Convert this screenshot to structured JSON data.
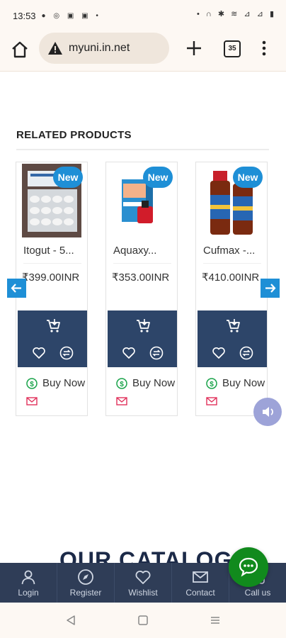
{
  "status_bar": {
    "time": "13:53",
    "left_icons": "● ◎ ▣ ▣ •",
    "right_icons": "• ∩ ✱ ≋ ⊿ ⊿ ▮"
  },
  "browser": {
    "url": "myuni.in.net",
    "tab_count": "35"
  },
  "section": {
    "title": "RELATED PRODUCTS"
  },
  "products": [
    {
      "name": "Itogut - 5...",
      "price": "₹399.00INR",
      "badge": "New",
      "buy_label": "Buy Now"
    },
    {
      "name": "Aquaxy...",
      "price": "₹353.00INR",
      "badge": "New",
      "buy_label": "Buy Now"
    },
    {
      "name": "Cufmax -...",
      "price": "₹410.00INR",
      "badge": "New",
      "buy_label": "Buy Now"
    }
  ],
  "catalog_heading": "OUR CATALOG",
  "bottom_nav": [
    {
      "label": "Login",
      "icon": "user-icon"
    },
    {
      "label": "Register",
      "icon": "compass-icon"
    },
    {
      "label": "Wishlist",
      "icon": "heart-icon"
    },
    {
      "label": "Contact",
      "icon": "mail-icon"
    },
    {
      "label": "Call us",
      "icon": "phone-icon"
    }
  ],
  "colors": {
    "accent": "#1e8fd6",
    "nav_bg": "#2f3d57",
    "card_action_bg": "#2d4569",
    "chat": "#118a1d",
    "buy_icon": "#1aa34a",
    "mail_icon": "#e0305a"
  }
}
